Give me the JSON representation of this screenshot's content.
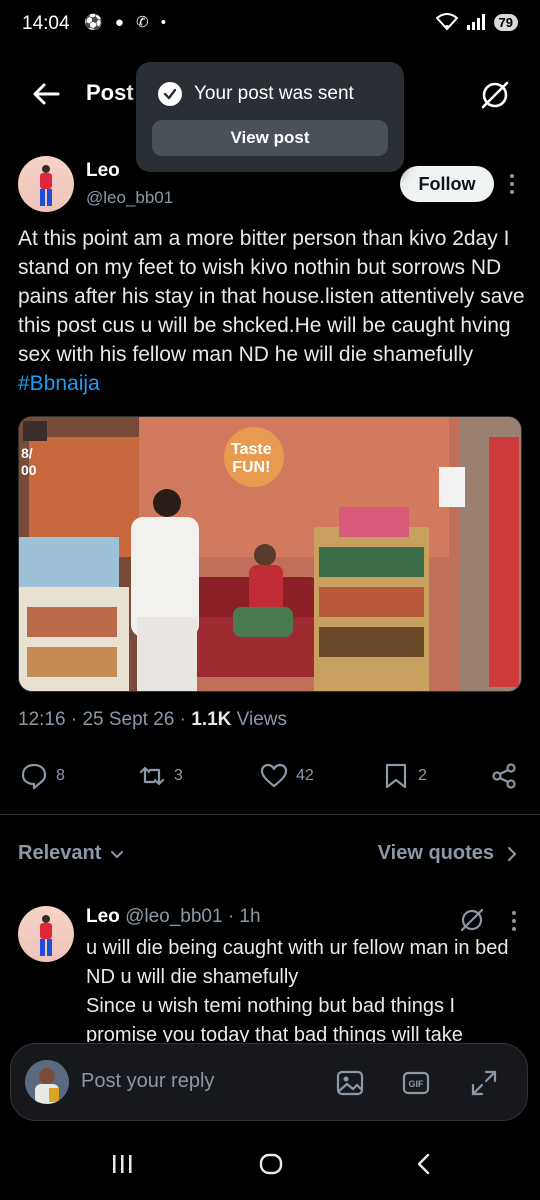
{
  "status_bar": {
    "time": "14:04",
    "icons": "⚽ ● ✆ •",
    "network": "5",
    "battery": "79"
  },
  "header": {
    "title": "Post"
  },
  "toast": {
    "message": "Your post was sent",
    "action": "View post"
  },
  "author": {
    "name": "Leo",
    "handle": "@leo_bb01",
    "follow_label": "Follow"
  },
  "post": {
    "text": "At this point am a more bitter person than kivo 2day I stand on my feet to wish kivo nothin but sorrows ND pains after his stay in that house.listen attentively save this post cus u will be shcked.He will be caught hving sex with his fellow man ND he will die shamefully ",
    "hashtag": "#Bbnaija",
    "media_overlay_text": "8/\n00",
    "media_sign_text": "Taste\nFUN!",
    "time": "12:16",
    "date": "25 Sept 26",
    "views_count": "1.1K",
    "views_label": "Views"
  },
  "actions": {
    "replies": "8",
    "reposts": "3",
    "likes": "42",
    "bookmarks": "2"
  },
  "filters": {
    "relevant": "Relevant",
    "view_quotes": "View quotes"
  },
  "reply": {
    "name": "Leo",
    "handle": "@leo_bb01",
    "age": "· 1h",
    "text": "u will die being caught with ur fellow man in bed ND u will die shamefully\nSince u wish temi nothing but bad things I promise you today that bad things will take"
  },
  "composer": {
    "placeholder": "Post your reply",
    "gif_label": "GIF"
  },
  "colors": {
    "accent": "#1d9bf0",
    "background": "#000000",
    "muted": "#8b98a5"
  }
}
